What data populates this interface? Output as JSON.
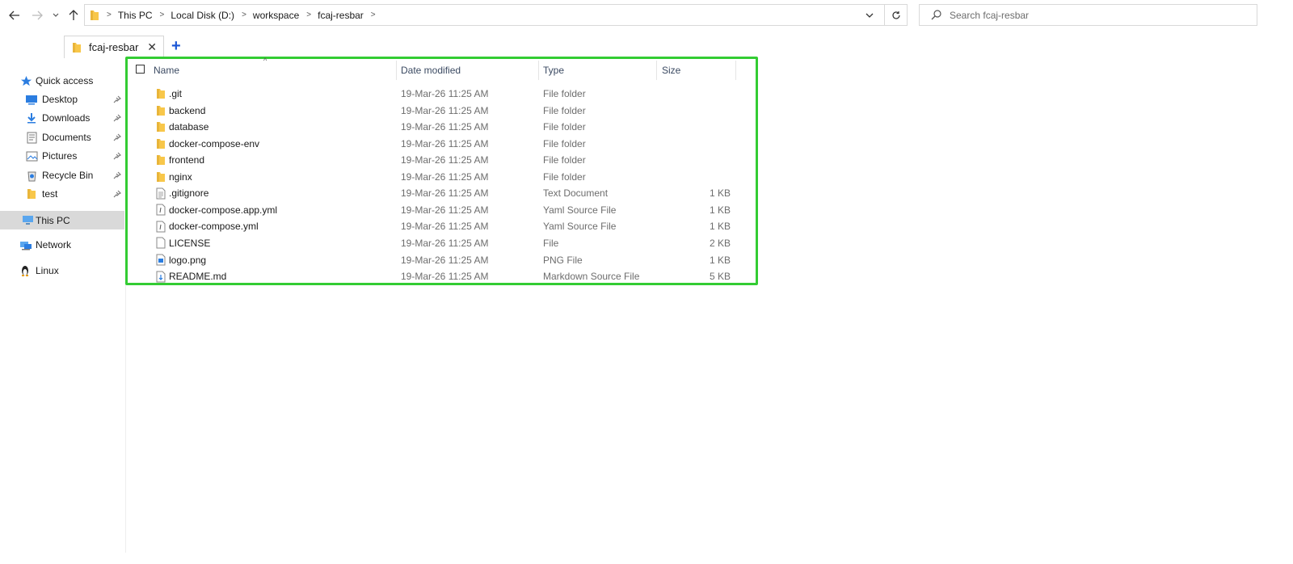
{
  "address": {
    "breadcrumbs": [
      "This PC",
      "Local Disk (D:)",
      "workspace",
      "fcaj-resbar"
    ]
  },
  "search": {
    "placeholder": "Search fcaj-resbar"
  },
  "tabs": [
    {
      "label": "fcaj-resbar",
      "close": "✕"
    }
  ],
  "new_tab": "+",
  "sidebar": {
    "quick_access": "Quick access",
    "pinned": [
      {
        "label": "Desktop",
        "icon": "desktop-icon"
      },
      {
        "label": "Downloads",
        "icon": "download-icon"
      },
      {
        "label": "Documents",
        "icon": "documents-icon"
      },
      {
        "label": "Pictures",
        "icon": "pictures-icon"
      },
      {
        "label": "Recycle Bin",
        "icon": "recycle-bin-icon"
      },
      {
        "label": "test",
        "icon": "folder-icon"
      }
    ],
    "this_pc": "This PC",
    "network": "Network",
    "linux": "Linux"
  },
  "columns": {
    "name": "Name",
    "date": "Date modified",
    "type": "Type",
    "size": "Size"
  },
  "files": [
    {
      "name": ".git",
      "date": "19-Mar-26 11:25 AM",
      "type": "File folder",
      "size": "",
      "icon": "folder"
    },
    {
      "name": "backend",
      "date": "19-Mar-26 11:25 AM",
      "type": "File folder",
      "size": "",
      "icon": "folder"
    },
    {
      "name": "database",
      "date": "19-Mar-26 11:25 AM",
      "type": "File folder",
      "size": "",
      "icon": "folder"
    },
    {
      "name": "docker-compose-env",
      "date": "19-Mar-26 11:25 AM",
      "type": "File folder",
      "size": "",
      "icon": "folder"
    },
    {
      "name": "frontend",
      "date": "19-Mar-26 11:25 AM",
      "type": "File folder",
      "size": "",
      "icon": "folder"
    },
    {
      "name": "nginx",
      "date": "19-Mar-26 11:25 AM",
      "type": "File folder",
      "size": "",
      "icon": "folder"
    },
    {
      "name": ".gitignore",
      "date": "19-Mar-26 11:25 AM",
      "type": "Text Document",
      "size": "1 KB",
      "icon": "text"
    },
    {
      "name": "docker-compose.app.yml",
      "date": "19-Mar-26 11:25 AM",
      "type": "Yaml Source File",
      "size": "1 KB",
      "icon": "yaml"
    },
    {
      "name": "docker-compose.yml",
      "date": "19-Mar-26 11:25 AM",
      "type": "Yaml Source File",
      "size": "1 KB",
      "icon": "yaml"
    },
    {
      "name": "LICENSE",
      "date": "19-Mar-26 11:25 AM",
      "type": "File",
      "size": "2 KB",
      "icon": "file"
    },
    {
      "name": "logo.png",
      "date": "19-Mar-26 11:25 AM",
      "type": "PNG File",
      "size": "1 KB",
      "icon": "image"
    },
    {
      "name": "README.md",
      "date": "19-Mar-26 11:25 AM",
      "type": "Markdown Source File",
      "size": "5 KB",
      "icon": "markdown"
    }
  ],
  "colors": {
    "highlight_border": "#33cc33",
    "folder_yellow": "#f8c74a",
    "accent_blue": "#1c57d6"
  }
}
